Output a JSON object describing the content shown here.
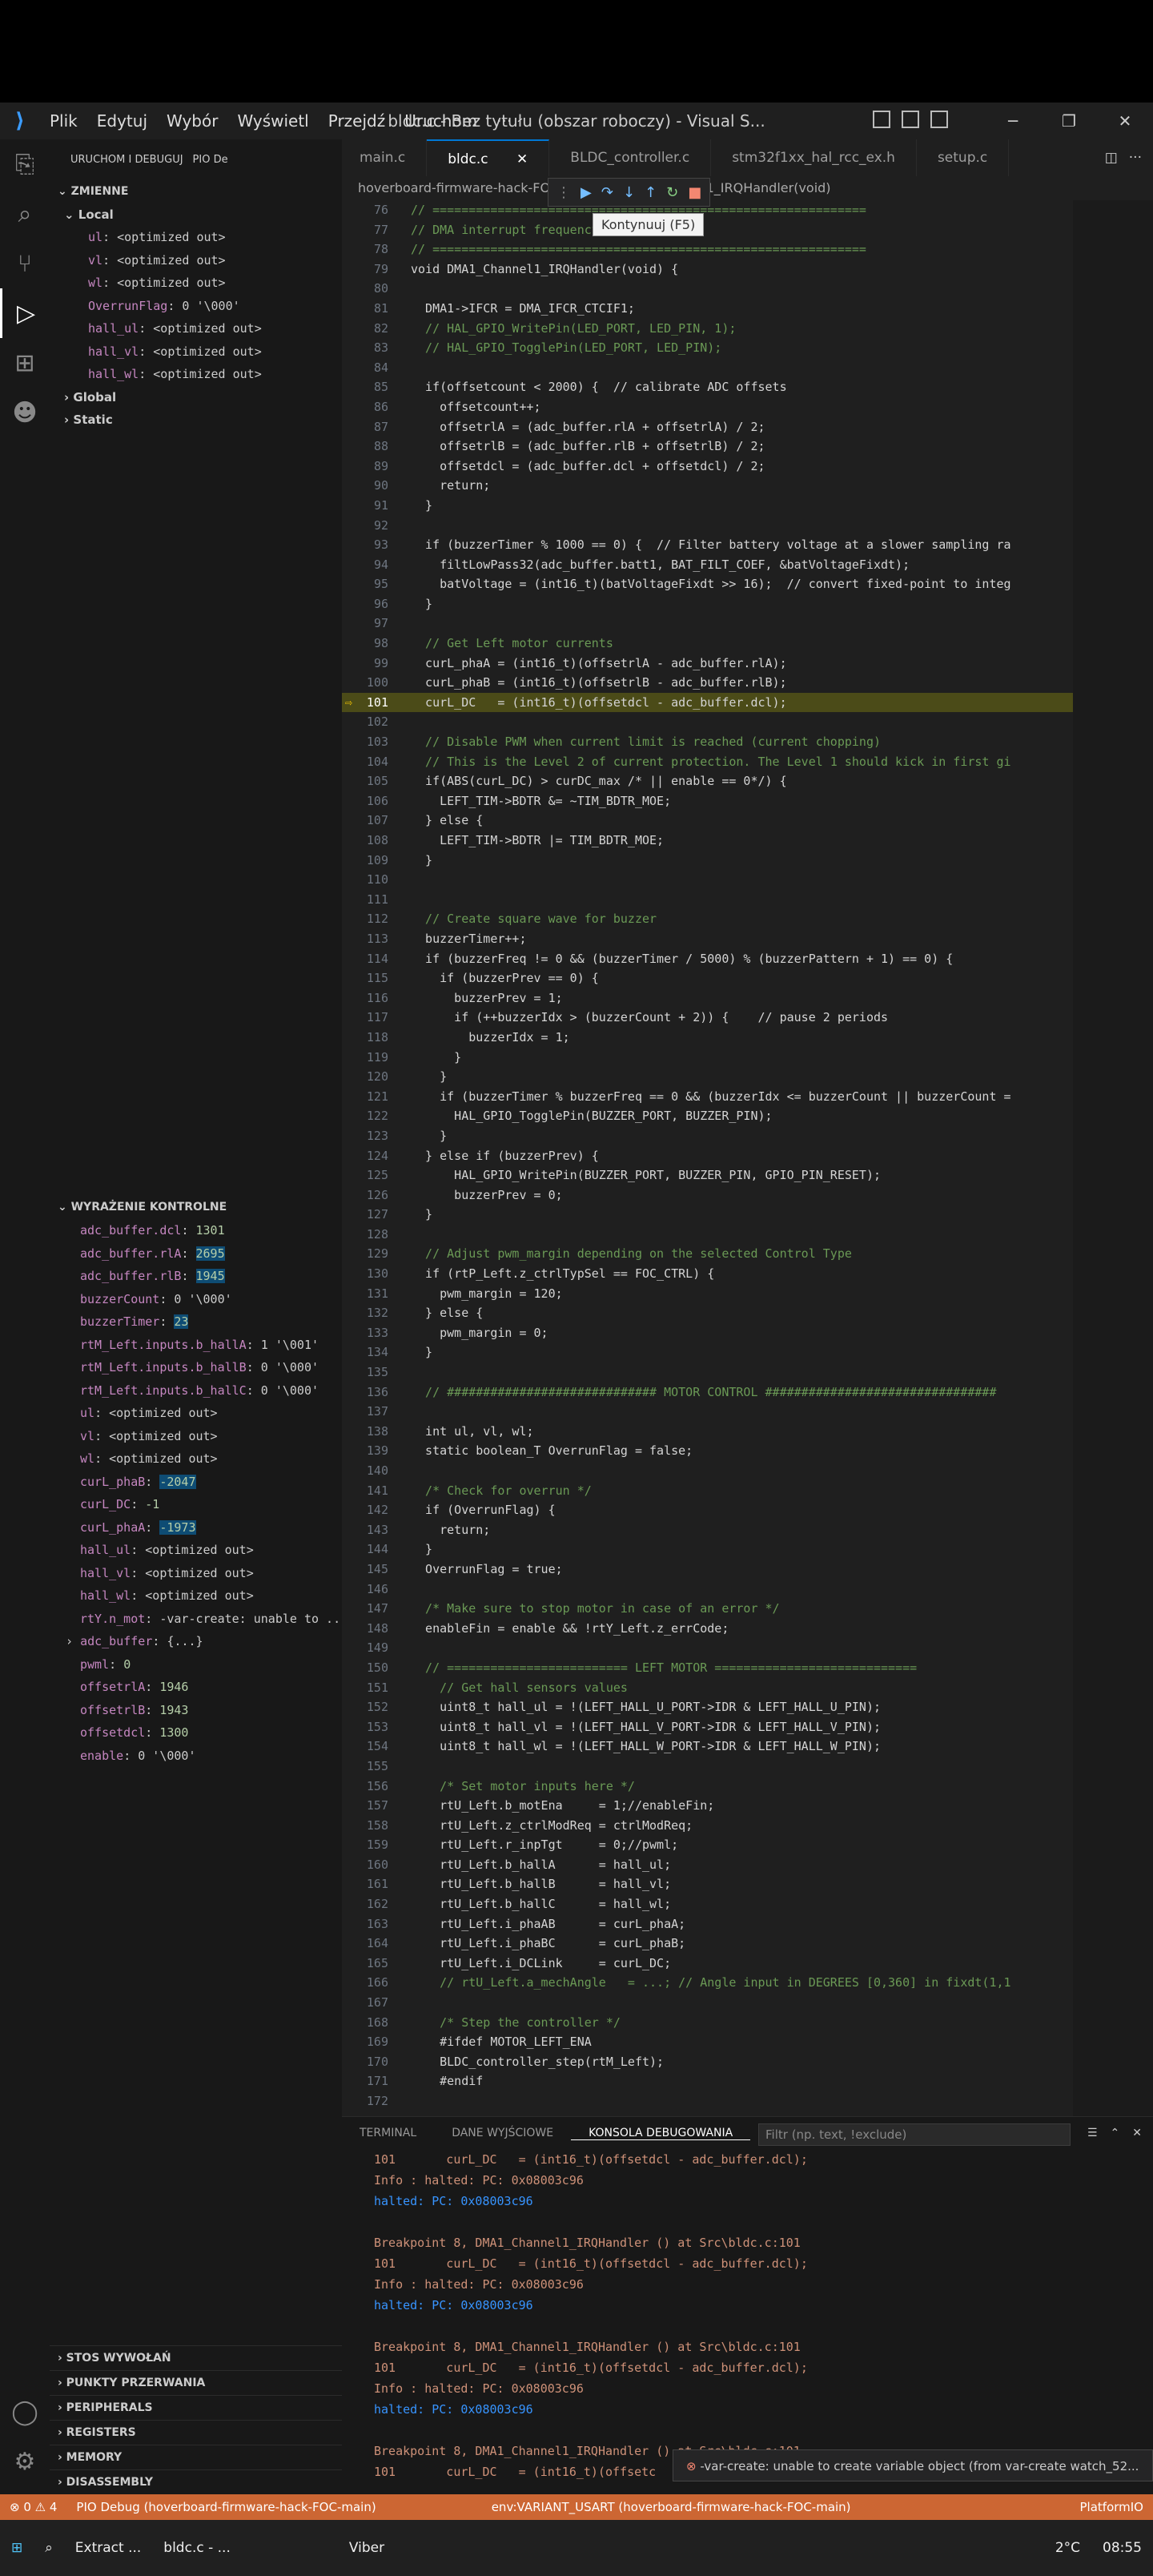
{
  "titlebar": {
    "menu": [
      "Plik",
      "Edytuj",
      "Wybór",
      "Wyświetl",
      "Przejdź",
      "Uruchom",
      "···"
    ],
    "title": "bldc.c - Bez tytułu (obszar roboczy) - Visual S..."
  },
  "sidebar": {
    "toolbar_label": "URUCHOM I DEBUGUJ",
    "config_label": "PIO De",
    "variables_title": "ZMIENNE",
    "local_title": "Local",
    "local_vars": [
      {
        "name": "ul",
        "value": "<optimized out>"
      },
      {
        "name": "vl",
        "value": "<optimized out>"
      },
      {
        "name": "wl",
        "value": "<optimized out>"
      },
      {
        "name": "OverrunFlag",
        "value": "0 '\\000'"
      },
      {
        "name": "hall_ul",
        "value": "<optimized out>"
      },
      {
        "name": "hall_vl",
        "value": "<optimized out>"
      },
      {
        "name": "hall_wl",
        "value": "<optimized out>"
      }
    ],
    "global_title": "Global",
    "static_title": "Static",
    "watch_title": "WYRAŻENIE KONTROLNE",
    "watch_vars": [
      {
        "name": "adc_buffer.dcl",
        "value": "1301",
        "hl": false
      },
      {
        "name": "adc_buffer.rlA",
        "value": "2695",
        "hl": true
      },
      {
        "name": "adc_buffer.rlB",
        "value": "1945",
        "hl": true
      },
      {
        "name": "buzzerCount",
        "value": "0 '\\000'",
        "hl": false
      },
      {
        "name": "buzzerTimer",
        "value": "23",
        "hl": true
      },
      {
        "name": "rtM_Left.inputs.b_hallA",
        "value": "1 '\\001'",
        "hl": false
      },
      {
        "name": "rtM_Left.inputs.b_hallB",
        "value": "0 '\\000'",
        "hl": false
      },
      {
        "name": "rtM_Left.inputs.b_hallC",
        "value": "0 '\\000'",
        "hl": false
      },
      {
        "name": "ul",
        "value": "<optimized out>",
        "hl": false
      },
      {
        "name": "vl",
        "value": "<optimized out>",
        "hl": false
      },
      {
        "name": "wl",
        "value": "<optimized out>",
        "hl": false
      },
      {
        "name": "curL_phaB",
        "value": "-2047",
        "hl": true
      },
      {
        "name": "curL_DC",
        "value": "-1",
        "hl": false
      },
      {
        "name": "curL_phaA",
        "value": "-1973",
        "hl": true
      },
      {
        "name": "hall_ul",
        "value": "<optimized out>",
        "hl": false
      },
      {
        "name": "hall_vl",
        "value": "<optimized out>",
        "hl": false
      },
      {
        "name": "hall_wl",
        "value": "<optimized out>",
        "hl": false
      },
      {
        "name": "rtY.n_mot",
        "value": "-var-create: unable to ...",
        "hl": false
      },
      {
        "name": "adc_buffer",
        "value": "{...}",
        "hl": false
      },
      {
        "name": "pwml",
        "value": "0",
        "hl": false
      },
      {
        "name": "offsetrlA",
        "value": "1946",
        "hl": false
      },
      {
        "name": "offsetrlB",
        "value": "1943",
        "hl": false
      },
      {
        "name": "offsetdcl",
        "value": "1300",
        "hl": false
      },
      {
        "name": "enable",
        "value": "0 '\\000'",
        "hl": false
      }
    ],
    "bottom_sections": [
      "STOS WYWOŁAŃ",
      "PUNKTY PRZERWANIA",
      "PERIPHERALS",
      "REGISTERS",
      "MEMORY",
      "DISASSEMBLY"
    ]
  },
  "tabs": [
    "main.c",
    "bldc.c",
    "BLDC_controller.c",
    "stm32f1xx_hal_rcc_ex.h",
    "setup.c"
  ],
  "breadcrumb": "hoverboard-firmware-hack-FOC > ... > DMA1_Channel1_IRQHandler(void)",
  "tooltip": "Kontynuuj (F5)",
  "code": [
    {
      "n": "76",
      "t": "// ============================================================"
    },
    {
      "n": "77",
      "t": "// DMA interrupt frequency"
    },
    {
      "n": "78",
      "t": "// ============================================================"
    },
    {
      "n": "79",
      "t": "void DMA1_Channel1_IRQHandler(void) {"
    },
    {
      "n": "80",
      "t": ""
    },
    {
      "n": "81",
      "t": "  DMA1->IFCR = DMA_IFCR_CTCIF1;"
    },
    {
      "n": "82",
      "t": "  // HAL_GPIO_WritePin(LED_PORT, LED_PIN, 1);"
    },
    {
      "n": "83",
      "t": "  // HAL_GPIO_TogglePin(LED_PORT, LED_PIN);"
    },
    {
      "n": "84",
      "t": ""
    },
    {
      "n": "85",
      "t": "  if(offsetcount < 2000) {  // calibrate ADC offsets"
    },
    {
      "n": "86",
      "t": "    offsetcount++;"
    },
    {
      "n": "87",
      "t": "    offsetrlA = (adc_buffer.rlA + offsetrlA) / 2;"
    },
    {
      "n": "88",
      "t": "    offsetrlB = (adc_buffer.rlB + offsetrlB) / 2;"
    },
    {
      "n": "89",
      "t": "    offsetdcl = (adc_buffer.dcl + offsetdcl) / 2;"
    },
    {
      "n": "90",
      "t": "    return;"
    },
    {
      "n": "91",
      "t": "  }"
    },
    {
      "n": "92",
      "t": ""
    },
    {
      "n": "93",
      "t": "  if (buzzerTimer % 1000 == 0) {  // Filter battery voltage at a slower sampling ra"
    },
    {
      "n": "94",
      "t": "    filtLowPass32(adc_buffer.batt1, BAT_FILT_COEF, &batVoltageFixdt);"
    },
    {
      "n": "95",
      "t": "    batVoltage = (int16_t)(batVoltageFixdt >> 16);  // convert fixed-point to integ"
    },
    {
      "n": "96",
      "t": "  }"
    },
    {
      "n": "97",
      "t": ""
    },
    {
      "n": "98",
      "t": "  // Get Left motor currents"
    },
    {
      "n": "99",
      "t": "  curL_phaA = (int16_t)(offsetrlA - adc_buffer.rlA);"
    },
    {
      "n": "100",
      "t": "  curL_phaB = (int16_t)(offsetrlB - adc_buffer.rlB);"
    },
    {
      "n": "101",
      "t": "  curL_DC   = (int16_t)(offsetdcl - adc_buffer.dcl);"
    },
    {
      "n": "102",
      "t": ""
    },
    {
      "n": "103",
      "t": "  // Disable PWM when current limit is reached (current chopping)"
    },
    {
      "n": "104",
      "t": "  // This is the Level 2 of current protection. The Level 1 should kick in first gi"
    },
    {
      "n": "105",
      "t": "  if(ABS(curL_DC) > curDC_max /* || enable == 0*/) {"
    },
    {
      "n": "106",
      "t": "    LEFT_TIM->BDTR &= ~TIM_BDTR_MOE;"
    },
    {
      "n": "107",
      "t": "  } else {"
    },
    {
      "n": "108",
      "t": "    LEFT_TIM->BDTR |= TIM_BDTR_MOE;"
    },
    {
      "n": "109",
      "t": "  }"
    },
    {
      "n": "110",
      "t": ""
    },
    {
      "n": "111",
      "t": ""
    },
    {
      "n": "112",
      "t": "  // Create square wave for buzzer"
    },
    {
      "n": "113",
      "t": "  buzzerTimer++;"
    },
    {
      "n": "114",
      "t": "  if (buzzerFreq != 0 && (buzzerTimer / 5000) % (buzzerPattern + 1) == 0) {"
    },
    {
      "n": "115",
      "t": "    if (buzzerPrev == 0) {"
    },
    {
      "n": "116",
      "t": "      buzzerPrev = 1;"
    },
    {
      "n": "117",
      "t": "      if (++buzzerIdx > (buzzerCount + 2)) {    // pause 2 periods"
    },
    {
      "n": "118",
      "t": "        buzzerIdx = 1;"
    },
    {
      "n": "119",
      "t": "      }"
    },
    {
      "n": "120",
      "t": "    }"
    },
    {
      "n": "121",
      "t": "    if (buzzerTimer % buzzerFreq == 0 && (buzzerIdx <= buzzerCount || buzzerCount ="
    },
    {
      "n": "122",
      "t": "      HAL_GPIO_TogglePin(BUZZER_PORT, BUZZER_PIN);"
    },
    {
      "n": "123",
      "t": "    }"
    },
    {
      "n": "124",
      "t": "  } else if (buzzerPrev) {"
    },
    {
      "n": "125",
      "t": "      HAL_GPIO_WritePin(BUZZER_PORT, BUZZER_PIN, GPIO_PIN_RESET);"
    },
    {
      "n": "126",
      "t": "      buzzerPrev = 0;"
    },
    {
      "n": "127",
      "t": "  }"
    },
    {
      "n": "128",
      "t": ""
    },
    {
      "n": "129",
      "t": "  // Adjust pwm_margin depending on the selected Control Type"
    },
    {
      "n": "130",
      "t": "  if (rtP_Left.z_ctrlTypSel == FOC_CTRL) {"
    },
    {
      "n": "131",
      "t": "    pwm_margin = 120;"
    },
    {
      "n": "132",
      "t": "  } else {"
    },
    {
      "n": "133",
      "t": "    pwm_margin = 0;"
    },
    {
      "n": "134",
      "t": "  }"
    },
    {
      "n": "135",
      "t": ""
    },
    {
      "n": "136",
      "t": "  // ############################# MOTOR CONTROL ################################"
    },
    {
      "n": "137",
      "t": ""
    },
    {
      "n": "138",
      "t": "  int ul, vl, wl;"
    },
    {
      "n": "139",
      "t": "  static boolean_T OverrunFlag = false;"
    },
    {
      "n": "140",
      "t": ""
    },
    {
      "n": "141",
      "t": "  /* Check for overrun */"
    },
    {
      "n": "142",
      "t": "  if (OverrunFlag) {"
    },
    {
      "n": "143",
      "t": "    return;"
    },
    {
      "n": "144",
      "t": "  }"
    },
    {
      "n": "145",
      "t": "  OverrunFlag = true;"
    },
    {
      "n": "146",
      "t": ""
    },
    {
      "n": "147",
      "t": "  /* Make sure to stop motor in case of an error */"
    },
    {
      "n": "148",
      "t": "  enableFin = enable && !rtY_Left.z_errCode;"
    },
    {
      "n": "149",
      "t": ""
    },
    {
      "n": "150",
      "t": "  // ========================= LEFT MOTOR ============================"
    },
    {
      "n": "151",
      "t": "    // Get hall sensors values"
    },
    {
      "n": "152",
      "t": "    uint8_t hall_ul = !(LEFT_HALL_U_PORT->IDR & LEFT_HALL_U_PIN);"
    },
    {
      "n": "153",
      "t": "    uint8_t hall_vl = !(LEFT_HALL_V_PORT->IDR & LEFT_HALL_V_PIN);"
    },
    {
      "n": "154",
      "t": "    uint8_t hall_wl = !(LEFT_HALL_W_PORT->IDR & LEFT_HALL_W_PIN);"
    },
    {
      "n": "155",
      "t": ""
    },
    {
      "n": "156",
      "t": "    /* Set motor inputs here */"
    },
    {
      "n": "157",
      "t": "    rtU_Left.b_motEna     = 1;//enableFin;"
    },
    {
      "n": "158",
      "t": "    rtU_Left.z_ctrlModReq = ctrlModReq;"
    },
    {
      "n": "159",
      "t": "    rtU_Left.r_inpTgt     = 0;//pwml;"
    },
    {
      "n": "160",
      "t": "    rtU_Left.b_hallA      = hall_ul;"
    },
    {
      "n": "161",
      "t": "    rtU_Left.b_hallB      = hall_vl;"
    },
    {
      "n": "162",
      "t": "    rtU_Left.b_hallC      = hall_wl;"
    },
    {
      "n": "163",
      "t": "    rtU_Left.i_phaAB      = curL_phaA;"
    },
    {
      "n": "164",
      "t": "    rtU_Left.i_phaBC      = curL_phaB;"
    },
    {
      "n": "165",
      "t": "    rtU_Left.i_DCLink     = curL_DC;"
    },
    {
      "n": "166",
      "t": "    // rtU_Left.a_mechAngle   = ...; // Angle input in DEGREES [0,360] in fixdt(1,1"
    },
    {
      "n": "167",
      "t": ""
    },
    {
      "n": "168",
      "t": "    /* Step the controller */"
    },
    {
      "n": "169",
      "t": "    #ifdef MOTOR_LEFT_ENA"
    },
    {
      "n": "170",
      "t": "    BLDC_controller_step(rtM_Left);"
    },
    {
      "n": "171",
      "t": "    #endif"
    },
    {
      "n": "172",
      "t": ""
    }
  ],
  "current_line": "101",
  "panel": {
    "tabs": [
      "TERMINAL",
      "DANE WYJŚCIOWE",
      "KONSOLA DEBUGOWANIA"
    ],
    "filter_placeholder": "Filtr (np. text, !exclude)",
    "console": [
      {
        "t": "101       curL_DC   = (int16_t)(offsetdcl - adc_buffer.dcl);",
        "c": "o"
      },
      {
        "t": "Info : halted: PC: 0x08003c96",
        "c": "o"
      },
      {
        "t": "halted: PC: 0x08003c96",
        "c": "b"
      },
      {
        "t": "",
        "c": "w"
      },
      {
        "t": "Breakpoint 8, DMA1_Channel1_IRQHandler () at Src\\bldc.c:101",
        "c": "o"
      },
      {
        "t": "101       curL_DC   = (int16_t)(offsetdcl - adc_buffer.dcl);",
        "c": "o"
      },
      {
        "t": "Info : halted: PC: 0x08003c96",
        "c": "o"
      },
      {
        "t": "halted: PC: 0x08003c96",
        "c": "b"
      },
      {
        "t": "",
        "c": "w"
      },
      {
        "t": "Breakpoint 8, DMA1_Channel1_IRQHandler () at Src\\bldc.c:101",
        "c": "o"
      },
      {
        "t": "101       curL_DC   = (int16_t)(offsetdcl - adc_buffer.dcl);",
        "c": "o"
      },
      {
        "t": "Info : halted: PC: 0x08003c96",
        "c": "o"
      },
      {
        "t": "halted: PC: 0x08003c96",
        "c": "b"
      },
      {
        "t": "",
        "c": "w"
      },
      {
        "t": "Breakpoint 8, DMA1_Channel1_IRQHandler () at Src\\bldc.c:101",
        "c": "o"
      },
      {
        "t": "101       curL_DC   = (int16_t)(offsetc",
        "c": "o"
      }
    ],
    "notification": "-var-create: unable to create variable object (from var-create watch_52..."
  },
  "statusbar": [
    "⊗ 0 ⚠ 4",
    "PIO Debug (hoverboard-firmware-hack-FOC-main)",
    "env:VARIANT_USART (hoverboard-firmware-hack-FOC-main)",
    "PlatformIO"
  ],
  "taskbar": {
    "items": [
      "Extract ...",
      "bldc.c - ...",
      "Viber"
    ],
    "temp": "2°C",
    "time": "08:55"
  },
  "colors": {
    "accent": "#0078d4",
    "status": "#cc6633",
    "current_line": "#4b4b18"
  }
}
